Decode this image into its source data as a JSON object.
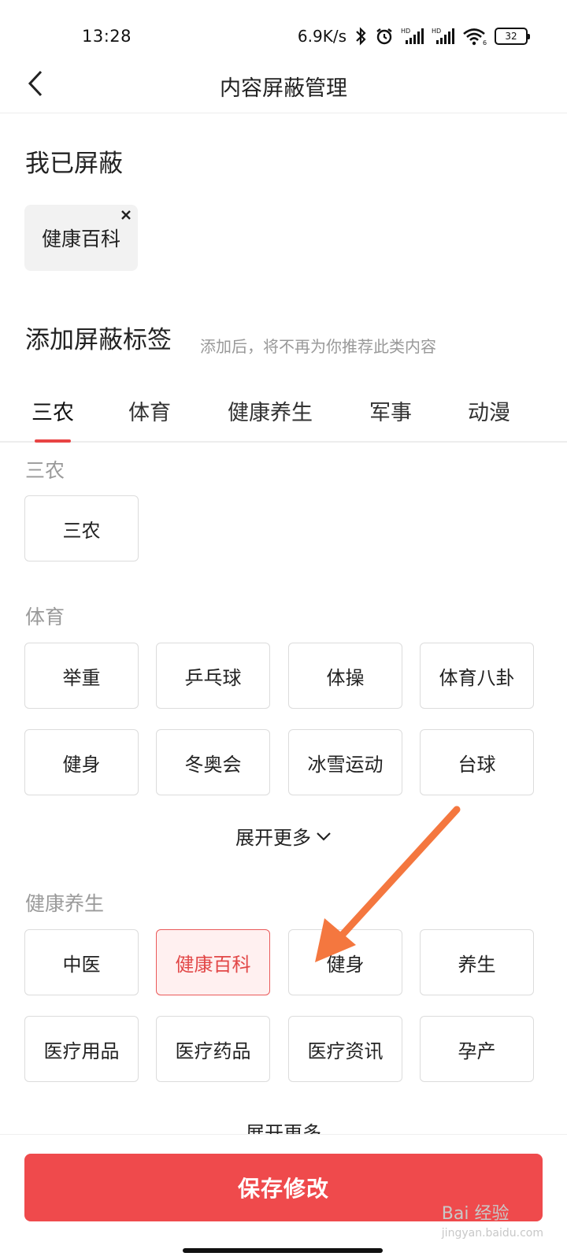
{
  "status_bar": {
    "time": "13:28",
    "net_speed": "6.9K/s",
    "battery": "32",
    "icons": [
      "bluetooth-icon",
      "alarm-icon",
      "signal-hd-icon",
      "signal-hd-icon",
      "wifi-icon",
      "battery-icon"
    ]
  },
  "nav": {
    "title": "内容屏蔽管理",
    "back_icon": "chevron-left-icon"
  },
  "blocked": {
    "title": "我已屏蔽",
    "items": [
      {
        "label": "健康百科"
      }
    ]
  },
  "add": {
    "title": "添加屏蔽标签",
    "hint": "添加后，将不再为你推荐此类内容"
  },
  "tabs": [
    {
      "label": "三农",
      "active": true
    },
    {
      "label": "体育",
      "active": false
    },
    {
      "label": "健康养生",
      "active": false
    },
    {
      "label": "军事",
      "active": false
    },
    {
      "label": "动漫",
      "active": false
    }
  ],
  "categories": [
    {
      "label": "三农",
      "tags": [
        {
          "label": "三农"
        }
      ]
    },
    {
      "label": "体育",
      "tags": [
        {
          "label": "举重"
        },
        {
          "label": "乒乓球"
        },
        {
          "label": "体操"
        },
        {
          "label": "体育八卦"
        },
        {
          "label": "健身"
        },
        {
          "label": "冬奥会"
        },
        {
          "label": "冰雪运动"
        },
        {
          "label": "台球"
        }
      ],
      "expand_label": "展开更多"
    },
    {
      "label": "健康养生",
      "tags": [
        {
          "label": "中医"
        },
        {
          "label": "健康百科",
          "selected": true
        },
        {
          "label": "健身"
        },
        {
          "label": "养生"
        },
        {
          "label": "医疗用品"
        },
        {
          "label": "医疗药品"
        },
        {
          "label": "医疗资讯"
        },
        {
          "label": "孕产"
        }
      ],
      "expand_label": "展开更多"
    }
  ],
  "footer": {
    "save_label": "保存修改"
  },
  "watermark": {
    "brand": "Bai 经验",
    "domain": "jingyan.baidu.com"
  },
  "colors": {
    "accent": "#ef4a4c",
    "selected_bg": "#fff0f0",
    "selected_text": "#e24848",
    "annotation_arrow": "#f4773f"
  }
}
